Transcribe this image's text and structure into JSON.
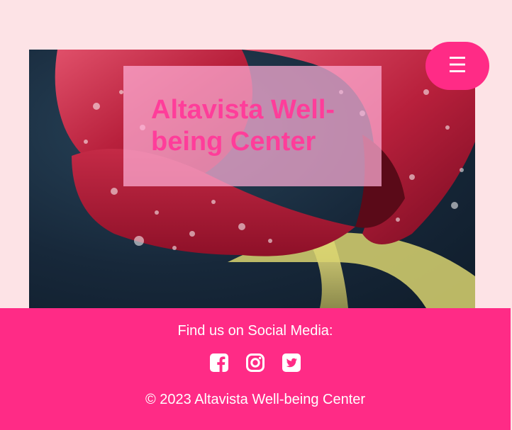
{
  "hero": {
    "title": "Altavista Well-being Center",
    "image_subject": "red tulip petals with water droplets"
  },
  "nav": {
    "menu_icon": "hamburger-menu-icon",
    "menu_glyph": "☰"
  },
  "footer": {
    "social_heading": "Find us on Social Media:",
    "social_links": [
      {
        "name": "facebook",
        "icon": "facebook-square-icon"
      },
      {
        "name": "instagram",
        "icon": "instagram-icon"
      },
      {
        "name": "twitter",
        "icon": "twitter-square-icon"
      }
    ],
    "copyright": "© 2023 Altavista Well-being Center"
  },
  "colors": {
    "page_background": "#fde3e6",
    "accent": "#ff2b86",
    "title_text": "#ff3d9a",
    "title_box": "#ffafd7",
    "footer_text": "#ffffff"
  }
}
